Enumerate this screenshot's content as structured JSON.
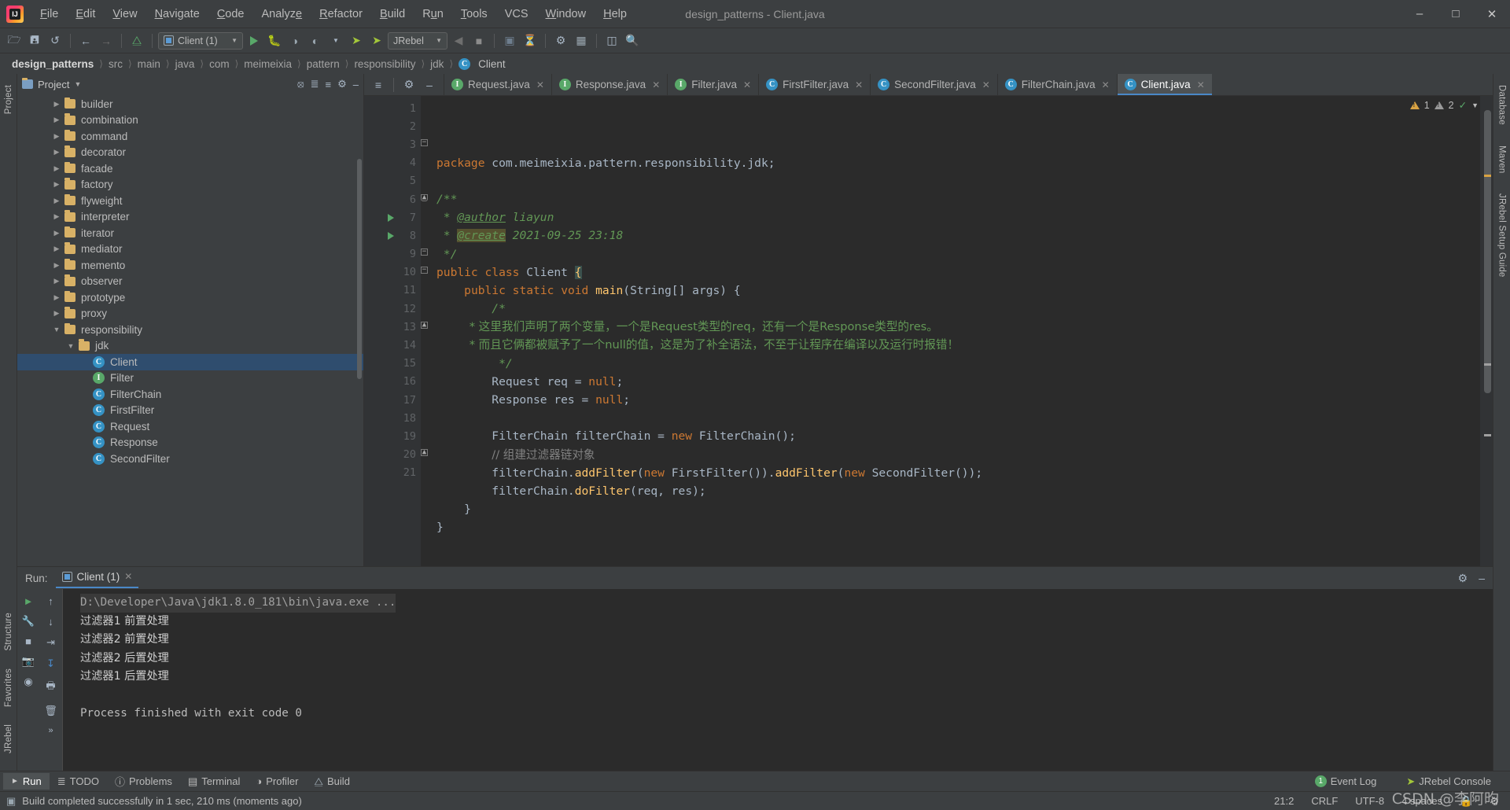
{
  "window": {
    "title": "design_patterns - Client.java",
    "logo_icon": "intellij-idea-logo",
    "minimize_icon": "minimize-icon",
    "maximize_icon": "maximize-icon",
    "close_icon": "close-icon"
  },
  "menubar": {
    "items": [
      {
        "label": "File"
      },
      {
        "label": "Edit"
      },
      {
        "label": "View"
      },
      {
        "label": "Navigate"
      },
      {
        "label": "Code"
      },
      {
        "label": "Analyze"
      },
      {
        "label": "Refactor"
      },
      {
        "label": "Build"
      },
      {
        "label": "Run"
      },
      {
        "label": "Tools"
      },
      {
        "label": "VCS"
      },
      {
        "label": "Window"
      },
      {
        "label": "Help"
      }
    ]
  },
  "toolbar": {
    "open_icon": "open-folder-icon",
    "save_icon": "save-all-icon",
    "sync_icon": "sync-refresh-icon",
    "back_icon": "navigate-back-icon",
    "forward_icon": "navigate-forward-icon",
    "build_icon": "build-hammer-icon",
    "run_config": "Client (1)",
    "run_icon": "run-icon",
    "debug_icon": "debug-bug-icon",
    "run_coverage_icon": "run-with-coverage-icon",
    "profile_icon": "profile-icon",
    "jrebel_run_icon": "jrebel-run-icon",
    "jrebel_debug_icon": "jrebel-debug-icon",
    "jrebel_config": "JRebel",
    "stop_icon": "stop-icon",
    "update_icon": "update-project-icon",
    "commit_icon": "commit-icon",
    "settings_icon": "settings-gear-icon",
    "project_structure_icon": "project-structure-icon",
    "sdk_icon": "sdk-manager-icon",
    "search_icon": "search-everywhere-icon"
  },
  "breadcrumb": {
    "items": [
      "design_patterns",
      "src",
      "main",
      "java",
      "com",
      "meimeixia",
      "pattern",
      "responsibility",
      "jdk",
      "Client"
    ],
    "last_icon": "java-class-icon"
  },
  "left_rail": {
    "items": [
      "Project",
      "Structure",
      "Favorites",
      "JRebel"
    ]
  },
  "right_rail": {
    "items": [
      "Database",
      "Maven",
      "JRebel Setup Guide"
    ]
  },
  "project_panel": {
    "title": "Project",
    "dropdown_icon": "chevron-down-icon",
    "locate_icon": "scroll-from-source-icon",
    "collapse_icon": "collapse-all-icon",
    "expand_icon": "expand-all-icon",
    "settings_icon": "gear-icon",
    "hide_icon": "hide-panel-icon",
    "tree": [
      {
        "label": "builder",
        "depth": 2,
        "type": "folder",
        "expanded": false,
        "selected": false
      },
      {
        "label": "combination",
        "depth": 2,
        "type": "folder",
        "expanded": false,
        "selected": false
      },
      {
        "label": "command",
        "depth": 2,
        "type": "folder",
        "expanded": false,
        "selected": false
      },
      {
        "label": "decorator",
        "depth": 2,
        "type": "folder",
        "expanded": false,
        "selected": false
      },
      {
        "label": "facade",
        "depth": 2,
        "type": "folder",
        "expanded": false,
        "selected": false
      },
      {
        "label": "factory",
        "depth": 2,
        "type": "folder",
        "expanded": false,
        "selected": false
      },
      {
        "label": "flyweight",
        "depth": 2,
        "type": "folder",
        "expanded": false,
        "selected": false
      },
      {
        "label": "interpreter",
        "depth": 2,
        "type": "folder",
        "expanded": false,
        "selected": false
      },
      {
        "label": "iterator",
        "depth": 2,
        "type": "folder",
        "expanded": false,
        "selected": false
      },
      {
        "label": "mediator",
        "depth": 2,
        "type": "folder",
        "expanded": false,
        "selected": false
      },
      {
        "label": "memento",
        "depth": 2,
        "type": "folder",
        "expanded": false,
        "selected": false
      },
      {
        "label": "observer",
        "depth": 2,
        "type": "folder",
        "expanded": false,
        "selected": false
      },
      {
        "label": "prototype",
        "depth": 2,
        "type": "folder",
        "expanded": false,
        "selected": false
      },
      {
        "label": "proxy",
        "depth": 2,
        "type": "folder",
        "expanded": false,
        "selected": false
      },
      {
        "label": "responsibility",
        "depth": 2,
        "type": "folder",
        "expanded": true,
        "selected": false
      },
      {
        "label": "jdk",
        "depth": 3,
        "type": "folder",
        "expanded": true,
        "selected": false
      },
      {
        "label": "Client",
        "depth": 4,
        "type": "class",
        "selected": true
      },
      {
        "label": "Filter",
        "depth": 4,
        "type": "interface",
        "selected": false
      },
      {
        "label": "FilterChain",
        "depth": 4,
        "type": "class",
        "selected": false
      },
      {
        "label": "FirstFilter",
        "depth": 4,
        "type": "class",
        "selected": false
      },
      {
        "label": "Request",
        "depth": 4,
        "type": "class",
        "selected": false
      },
      {
        "label": "Response",
        "depth": 4,
        "type": "class",
        "selected": false
      },
      {
        "label": "SecondFilter",
        "depth": 4,
        "type": "class",
        "selected": false
      }
    ]
  },
  "editor_tabs": {
    "tools": [
      "expand-collapse-icon",
      "gear-icon",
      "hide-icon"
    ],
    "items": [
      {
        "label": "Request.java",
        "icon": "java-interface-icon",
        "active": false
      },
      {
        "label": "Response.java",
        "icon": "java-interface-icon",
        "active": false
      },
      {
        "label": "Filter.java",
        "icon": "java-interface-icon",
        "active": false
      },
      {
        "label": "FirstFilter.java",
        "icon": "java-class-icon",
        "active": false
      },
      {
        "label": "SecondFilter.java",
        "icon": "java-class-icon",
        "active": false
      },
      {
        "label": "FilterChain.java",
        "icon": "java-class-icon",
        "active": false
      },
      {
        "label": "Client.java",
        "icon": "java-class-icon",
        "active": true
      }
    ],
    "close_icon": "close-tab-icon"
  },
  "inspections": {
    "warning_count": "1",
    "weak_warning_count": "2",
    "check_icon": "inspection-ok-icon",
    "chevron_icon": "chevron-down-icon"
  },
  "code": {
    "line_numbers": [
      "1",
      "2",
      "3",
      "4",
      "5",
      "6",
      "7",
      "8",
      "9",
      "10",
      "11",
      "12",
      "13",
      "14",
      "15",
      "16",
      "17",
      "18",
      "19",
      "20",
      "21"
    ],
    "lines": [
      "package com.meimeixia.pattern.responsibility.jdk;",
      "",
      "/**",
      " * @author liayun",
      " * @create 2021-09-25 23:18",
      " */",
      "public class Client {",
      "    public static void main(String[] args) {",
      "        /*",
      "         * 这里我们声明了两个变量，一个是Request类型的req，还有一个是Response类型的res。",
      "         * 而且它俩都被赋予了一个null的值，这是为了补全语法，不至于让程序在编译以及运行时报错！",
      "         */",
      "        Request req = null;",
      "        Response res = null;",
      "",
      "        FilterChain filterChain = new FilterChain();",
      "        // 组建过滤器链对象",
      "        filterChain.addFilter(new FirstFilter()).addFilter(new SecondFilter());",
      "        filterChain.doFilter(req, res);",
      "    }",
      "}"
    ]
  },
  "run_panel": {
    "label": "Run:",
    "tab_label": "Client (1)",
    "tab_icon": "run-configuration-icon",
    "close_icon": "close-icon",
    "settings_icon": "gear-icon",
    "hide_icon": "hide-panel-icon",
    "side_icons": [
      "rerun-icon",
      "scroll-up-icon",
      "wrench-icon",
      "scroll-down-icon",
      "stop-icon",
      "soft-wrap-icon",
      "camera-icon",
      "scroll-to-end-icon",
      "filter-icon",
      "print-icon",
      "trash-icon",
      "more-icon"
    ],
    "console_lines": [
      {
        "text": "D:\\Developer\\Java\\jdk1.8.0_181\\bin\\java.exe ...",
        "style": "path"
      },
      {
        "text": "过滤器1 前置处理",
        "style": "cjk"
      },
      {
        "text": "过滤器2 前置处理",
        "style": "cjk"
      },
      {
        "text": "过滤器2 后置处理",
        "style": "cjk"
      },
      {
        "text": "过滤器1 后置处理",
        "style": "cjk"
      },
      {
        "text": "",
        "style": "plain"
      },
      {
        "text": "Process finished with exit code 0",
        "style": "plain"
      }
    ]
  },
  "toolwindow_bar": {
    "items": [
      {
        "label": "Run",
        "icon": "run-icon",
        "active": true
      },
      {
        "label": "TODO",
        "icon": "todo-icon",
        "active": false
      },
      {
        "label": "Problems",
        "icon": "problems-icon",
        "active": false
      },
      {
        "label": "Terminal",
        "icon": "terminal-icon",
        "active": false
      },
      {
        "label": "Profiler",
        "icon": "profiler-icon",
        "active": false
      },
      {
        "label": "Build",
        "icon": "build-hammer-icon",
        "active": false
      }
    ],
    "right": [
      {
        "label": "Event Log",
        "icon": "event-log-icon",
        "badge": "1"
      },
      {
        "label": "JRebel Console",
        "icon": "jrebel-icon",
        "badge": ""
      }
    ]
  },
  "statusbar": {
    "message": "Build completed successfully in 1 sec, 210 ms (moments ago)",
    "message_icon": "build-status-icon",
    "caret_position": "21:2",
    "line_separator": "CRLF",
    "encoding": "UTF-8",
    "indent": "4 spaces",
    "lock_icon": "lock-icon",
    "watermark": "CSDN @李阿昀"
  },
  "colors": {
    "accent": "#4a88c7",
    "selection": "#2f4d6e",
    "class_icon": "#3592c4",
    "interface_icon": "#59a869",
    "keyword": "#cc7832",
    "comment": "#629755",
    "method": "#ffc66d",
    "editor_bg": "#2b2b2b",
    "chrome_bg": "#3c3f41"
  }
}
